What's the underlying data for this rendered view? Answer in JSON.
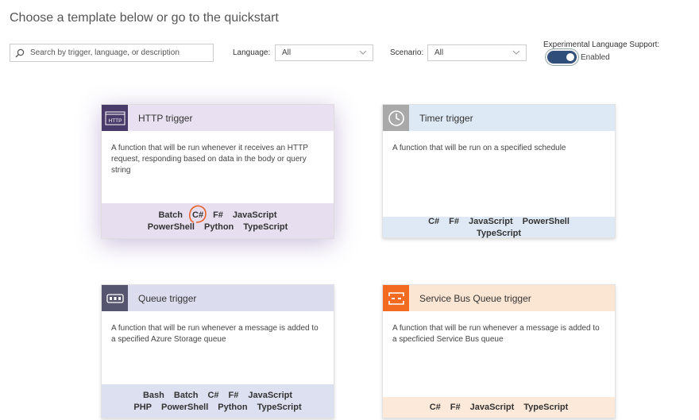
{
  "header": {
    "title": "Choose a template below or go to the quickstart"
  },
  "search": {
    "placeholder": "Search by trigger, language, or description"
  },
  "filters": {
    "language_label": "Language:",
    "language_value": "All",
    "scenario_label": "Scenario:",
    "scenario_value": "All",
    "experimental_label": "Experimental Language Support:",
    "experimental_state": "Enabled"
  },
  "colors": {
    "http_head": "#e9e1f1",
    "http_icon": "#4a3a6a",
    "http_langs": "#e7dff0",
    "timer_head": "#dde9f4",
    "timer_icon": "#a9a9a9",
    "timer_langs": "#dfe9f5",
    "queue_head": "#dcdcef",
    "queue_icon": "#555570",
    "queue_langs": "#dde0f0",
    "sb_head": "#fbe6d4",
    "sb_icon": "#f26b21",
    "sb_langs": "#fce9da",
    "toggle": "#2f4f7a",
    "annotation": "#e8622a"
  },
  "cards": [
    {
      "title": "HTTP trigger",
      "icon": "http-icon",
      "icon_text": "HTTP",
      "description": "A function that will be run whenever it receives an HTTP request, responding based on data in the body or query string",
      "languages": [
        "Batch",
        "C#",
        "F#",
        "JavaScript",
        "PowerShell",
        "Python",
        "TypeScript"
      ]
    },
    {
      "title": "Timer trigger",
      "icon": "clock-icon",
      "description": "A function that will be run on a specified schedule",
      "languages": [
        "C#",
        "F#",
        "JavaScript",
        "PowerShell",
        "TypeScript"
      ]
    },
    {
      "title": "Queue trigger",
      "icon": "queue-icon",
      "description": "A function that will be run whenever a message is added to a specified Azure Storage queue",
      "languages": [
        "Bash",
        "Batch",
        "C#",
        "F#",
        "JavaScript",
        "PHP",
        "PowerShell",
        "Python",
        "TypeScript"
      ]
    },
    {
      "title": "Service Bus Queue trigger",
      "icon": "service-bus-icon",
      "description": "A function that will be run whenever a message is added to a specficied Service Bus queue",
      "languages": [
        "C#",
        "F#",
        "JavaScript",
        "TypeScript"
      ]
    }
  ]
}
